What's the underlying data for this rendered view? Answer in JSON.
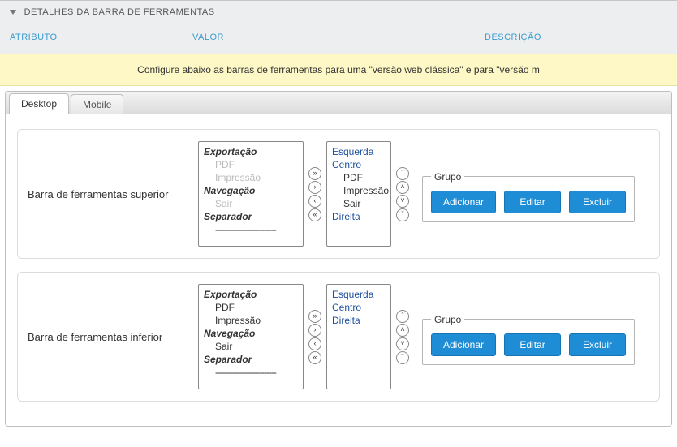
{
  "header": {
    "title": "DETALHES DA BARRA DE FERRAMENTAS",
    "columns": {
      "attr": "ATRIBUTO",
      "value": "VALOR",
      "desc": "DESCRIÇÃO"
    }
  },
  "notice": "Configure abaixo as barras de ferramentas para uma \"versão web clássica\" e para \"versão m",
  "tabs": {
    "desktop": "Desktop",
    "mobile": "Mobile"
  },
  "arrows": {
    "right2": "»",
    "right1": "›",
    "left1": "‹",
    "left2": "«",
    "up2": "ˆ",
    "up1": "˄",
    "down1": "˅",
    "down2": "ˇ"
  },
  "groupLegend": "Grupo",
  "buttons": {
    "add": "Adicionar",
    "edit": "Editar",
    "delete": "Excluir"
  },
  "top": {
    "label": "Barra de ferramentas superior",
    "source": {
      "g1": "Exportação",
      "g1a": "PDF",
      "g1b": "Impressão",
      "g2": "Navegação",
      "g2a": "Sair",
      "g3": "Separador",
      "sep": "-------------------------"
    },
    "target": {
      "s1": "Esquerda",
      "s2": "Centro",
      "i1": "PDF",
      "i2": "Impressão",
      "i3": "Sair",
      "s3": "Direita"
    }
  },
  "bottom": {
    "label": "Barra de ferramentas inferior",
    "source": {
      "g1": "Exportação",
      "g1a": "PDF",
      "g1b": "Impressão",
      "g2": "Navegação",
      "g2a": "Sair",
      "g3": "Separador",
      "sep": "-------------------------"
    },
    "target": {
      "s1": "Esquerda",
      "s2": "Centro",
      "s3": "Direita"
    }
  }
}
